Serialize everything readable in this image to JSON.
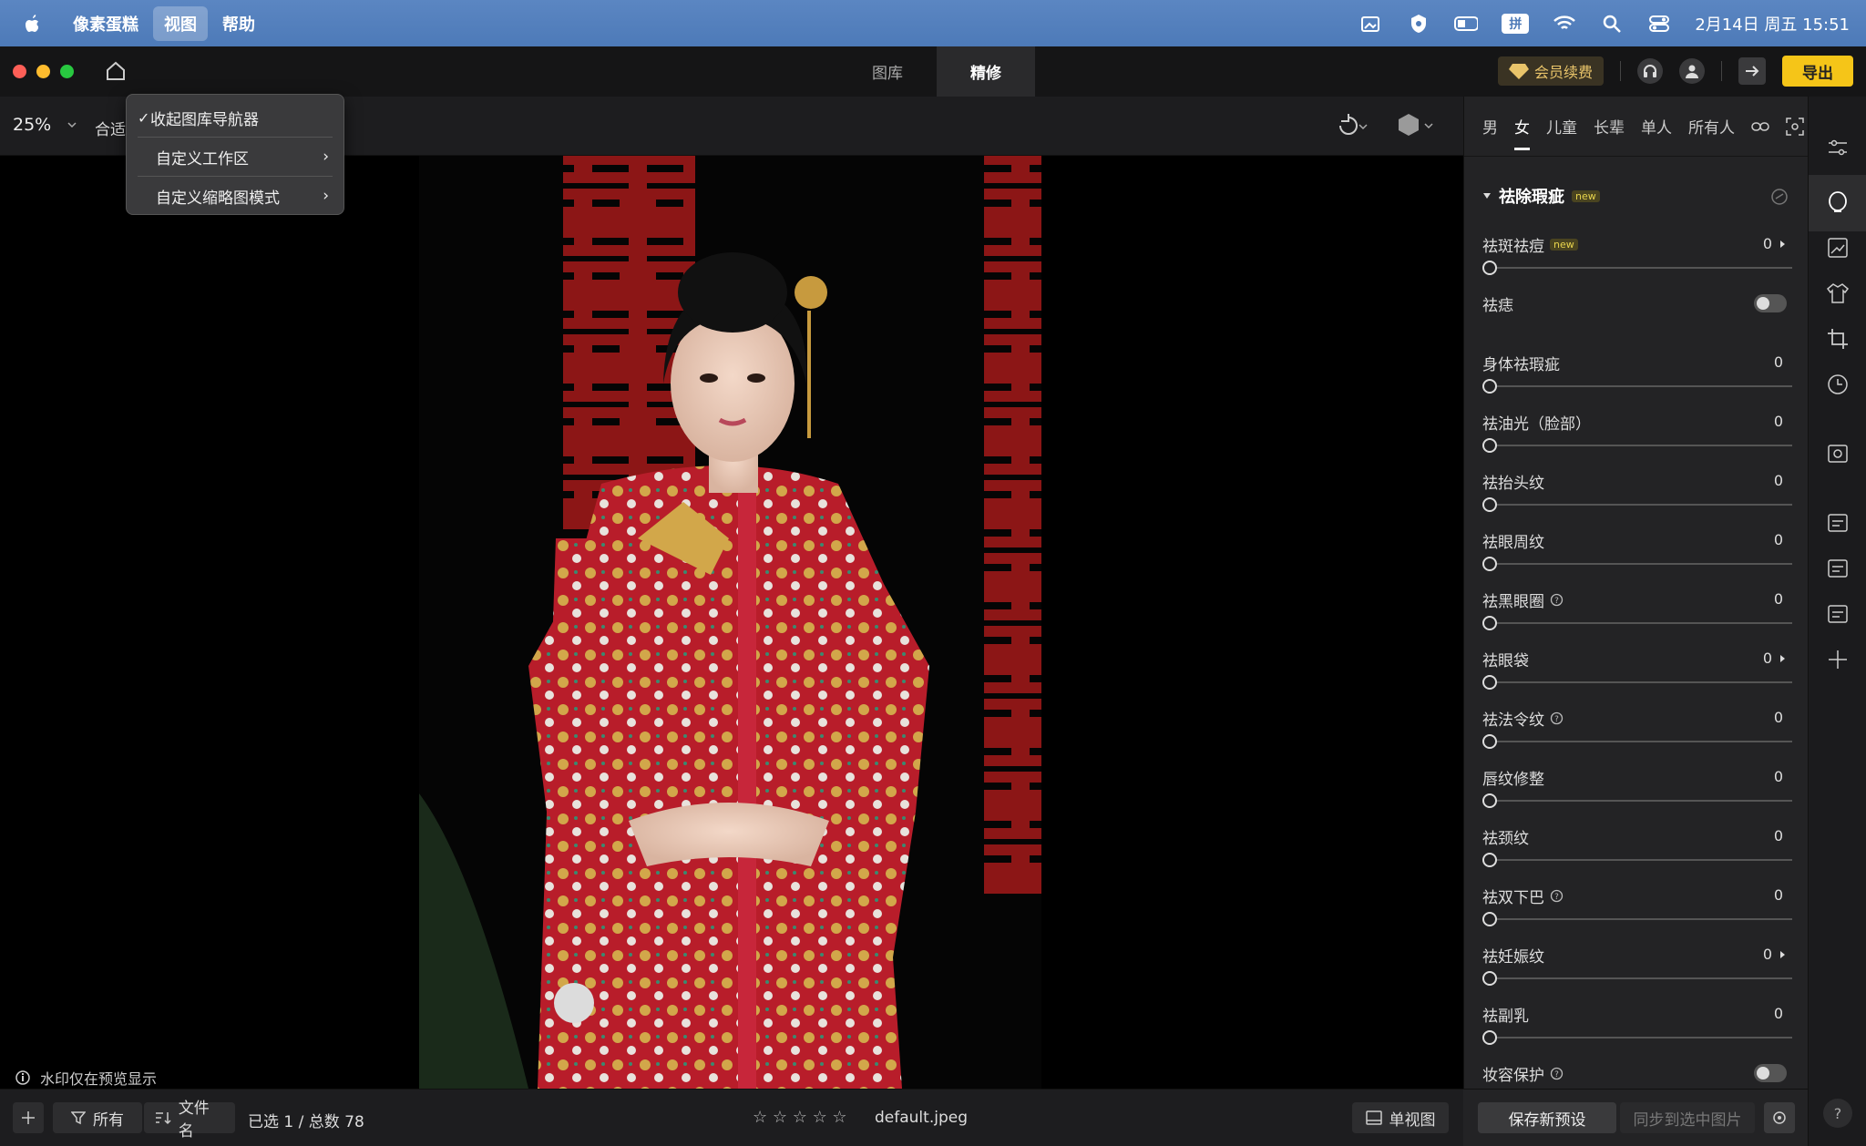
{
  "menubar": {
    "app_name": "像素蛋糕",
    "menus": [
      "视图",
      "帮助"
    ],
    "active_menu": "视图",
    "datetime": "2月14日 周五 15:51",
    "ime": "拼"
  },
  "dropdown": {
    "items": [
      {
        "label": "收起图库导航器",
        "checked": true
      },
      {
        "label": "自定义工作区",
        "submenu": true
      },
      {
        "label": "自定义缩略图模式",
        "submenu": true
      }
    ],
    "check": "✓",
    "chev": "›"
  },
  "tabs": [
    "图库",
    "精修"
  ],
  "active_tab": "精修",
  "topright": {
    "vip_label": "会员续费",
    "export_label": "导出"
  },
  "toolbar": {
    "zoom": "25%",
    "fit": "合适"
  },
  "canvas": {
    "watermark_note": "水印仅在预览显示"
  },
  "persons": {
    "items": [
      "男",
      "女",
      "儿童",
      "长辈",
      "单人",
      "所有人"
    ],
    "selected": "女"
  },
  "section": {
    "title": "祛除瑕疵",
    "badge": "new"
  },
  "sliders": [
    {
      "label": "祛斑祛痘",
      "badge": "new",
      "value": "0",
      "arrow": true
    },
    {
      "label": "祛痣",
      "toggle": true
    },
    {
      "label": "身体祛瑕疵",
      "value": "0"
    },
    {
      "label": "祛油光（脸部）",
      "value": "0"
    },
    {
      "label": "祛抬头纹",
      "value": "0"
    },
    {
      "label": "祛眼周纹",
      "value": "0"
    },
    {
      "label": "祛黑眼圈",
      "help": true,
      "value": "0"
    },
    {
      "label": "祛眼袋",
      "value": "0",
      "arrow": true
    },
    {
      "label": "祛法令纹",
      "help": true,
      "value": "0"
    },
    {
      "label": "唇纹修整",
      "value": "0"
    },
    {
      "label": "祛颈纹",
      "value": "0"
    },
    {
      "label": "祛双下巴",
      "help": true,
      "value": "0"
    },
    {
      "label": "祛妊娠纹",
      "value": "0",
      "arrow": true
    },
    {
      "label": "祛副乳",
      "value": "0"
    },
    {
      "label": "妆容保护",
      "help": true,
      "toggle": true
    }
  ],
  "bottombar": {
    "filter_label": "所有",
    "sort_label": "文件名",
    "count_text": "已选 1 / 总数 78",
    "filename": "default.jpeg",
    "stars": "☆ ☆ ☆ ☆ ☆",
    "view_label": "单视图"
  },
  "rbottom": {
    "save_preset": "保存新预设",
    "sync": "同步到选中图片",
    "help": "?"
  },
  "colors": {
    "accent": "#f5c518",
    "menubar": "#5b86c2",
    "panel": "#232325"
  }
}
